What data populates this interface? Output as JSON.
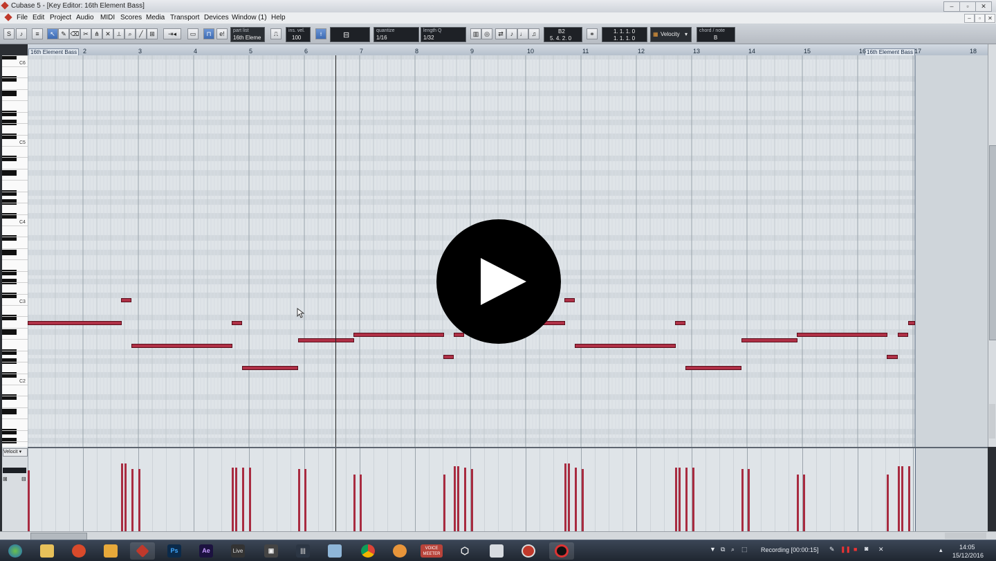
{
  "window": {
    "title": "Cubase 5 - [Key Editor: 16th Element Bass]"
  },
  "menu": [
    "File",
    "Edit",
    "Project",
    "Audio",
    "MIDI",
    "Scores",
    "Media",
    "Transport",
    "Devices",
    "Window (1)",
    "Help"
  ],
  "toolbar": {
    "part_list_label": "part list",
    "part_list_value": "16th Eleme",
    "ins_vel_label": "ins. vel.",
    "ins_vel_value": "100",
    "quantize_label": "quantize",
    "quantize_value": "1/16",
    "length_q_label": "length Q",
    "length_q_value": "1/32",
    "pitch_value": "B2",
    "mouse_position": "5. 4. 2.   0",
    "pos_top": "1. 1. 1.   0",
    "pos_bottom": "1. 1. 1.   0",
    "controller_select": "Velocity",
    "chord_label": "chord / note",
    "chord_value": "B"
  },
  "ruler": {
    "part_start_label": "16th Element Bass",
    "part_end_label": "16th Element Bass",
    "bars": [
      "2",
      "3",
      "4",
      "5",
      "6",
      "7",
      "8",
      "9",
      "10",
      "11",
      "12",
      "13",
      "14",
      "15",
      "16",
      "17",
      "18"
    ]
  },
  "keyboard": {
    "octave_labels": [
      "C6",
      "C5",
      "C4",
      "C3",
      "C2"
    ]
  },
  "lane": {
    "controller": "Velocit"
  },
  "taskbar": {
    "apps": [
      {
        "name": "start",
        "label": ""
      },
      {
        "name": "explorer",
        "label": ""
      },
      {
        "name": "browser",
        "label": ""
      },
      {
        "name": "reaper",
        "label": ""
      },
      {
        "name": "cubase",
        "label": ""
      },
      {
        "name": "photoshop",
        "label": "Ps"
      },
      {
        "name": "after-effects",
        "label": "Ae"
      },
      {
        "name": "ableton-live",
        "label": "Live"
      },
      {
        "name": "video",
        "label": ""
      },
      {
        "name": "audio-editor",
        "label": ""
      },
      {
        "name": "notes",
        "label": ""
      },
      {
        "name": "chrome",
        "label": ""
      },
      {
        "name": "media",
        "label": ""
      },
      {
        "name": "voicemeeter",
        "label": "VOICE\nMEETER"
      },
      {
        "name": "package",
        "label": ""
      },
      {
        "name": "files",
        "label": ""
      },
      {
        "name": "recorder",
        "label": ""
      },
      {
        "name": "record",
        "label": ""
      }
    ],
    "recording_status": "Recording [00:00:15]",
    "time": "14:05",
    "date": "15/12/2016"
  },
  "colors": {
    "note": "#b03046",
    "velocity": "#a82b40",
    "grid_bg": "#dfe4e8",
    "taskbar": "#26303c"
  }
}
